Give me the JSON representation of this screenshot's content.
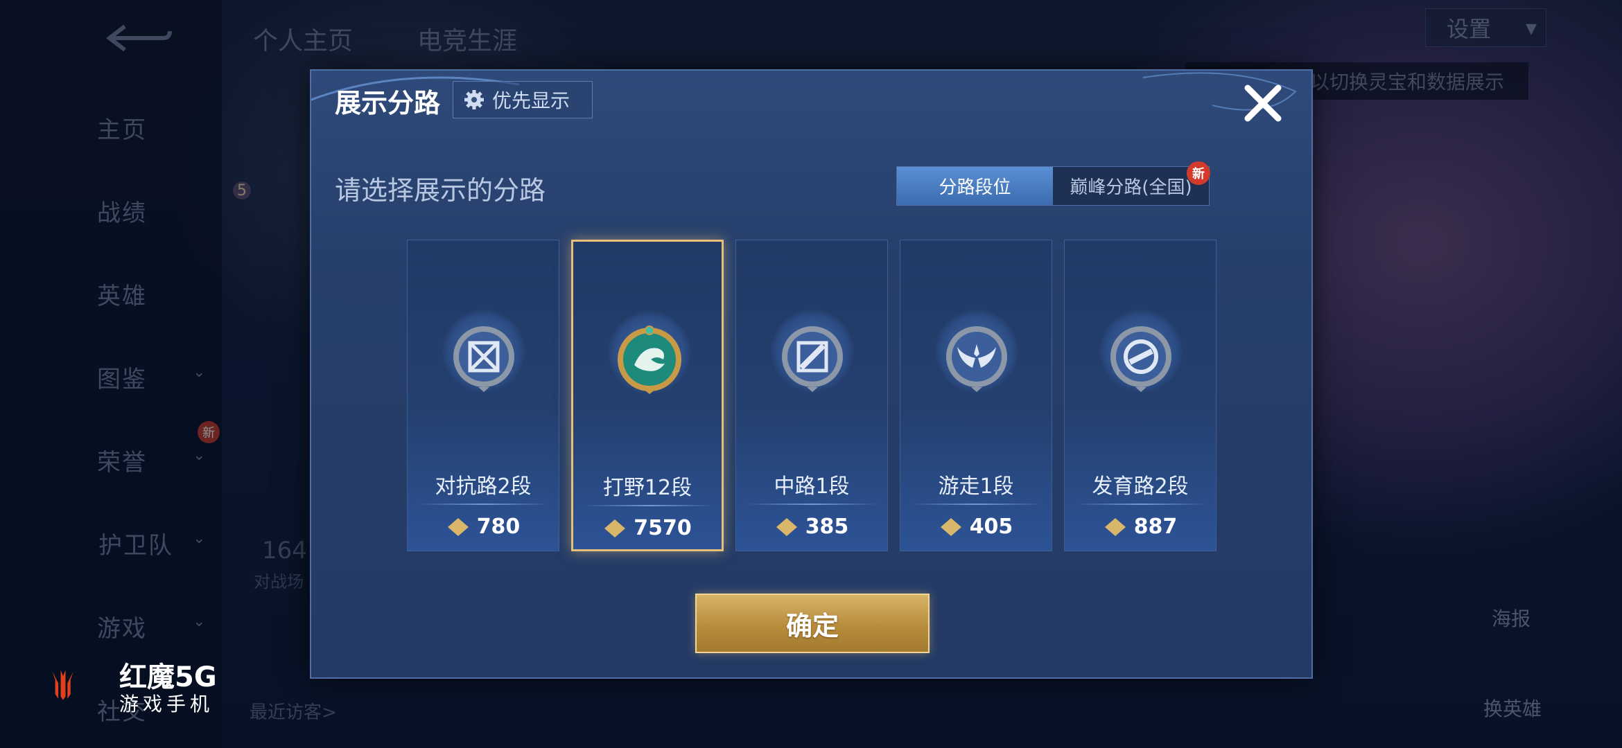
{
  "background": {
    "top_tabs": [
      "个人主页",
      "电竞生涯"
    ],
    "sidebar": {
      "items": [
        {
          "label": "主页"
        },
        {
          "label": "战绩"
        },
        {
          "label": "英雄"
        },
        {
          "label": "图鉴"
        },
        {
          "label": "荣誉"
        },
        {
          "label": "护卫队"
        },
        {
          "label": "游戏"
        },
        {
          "label": "社交"
        }
      ],
      "new_badge": "新"
    },
    "settings_label": "设置",
    "hint_text": "以切换灵宝和数据展示",
    "poster_label": "海报",
    "switch_hero_label": "换英雄",
    "recent_visitors": "最近访客>",
    "level": "5",
    "partial_stat_value": "164",
    "partial_stat_label": "对战场",
    "brand": {
      "name": "红魔5G",
      "sub": "游戏手机"
    }
  },
  "modal": {
    "title": "展示分路",
    "priority_label": "优先显示",
    "subtitle": "请选择展示的分路",
    "segment": {
      "active_label": "分路段位",
      "inactive_label": "巅峰分路(全国)",
      "new_badge": "新"
    },
    "cards": [
      {
        "label": "对抗路2段",
        "score": "780",
        "icon": "clash-lane-badge",
        "selected": false
      },
      {
        "label": "打野12段",
        "score": "7570",
        "icon": "jungle-dragon-badge",
        "selected": true
      },
      {
        "label": "中路1段",
        "score": "385",
        "icon": "mid-lane-badge",
        "selected": false
      },
      {
        "label": "游走1段",
        "score": "405",
        "icon": "roam-wing-badge",
        "selected": false
      },
      {
        "label": "发育路2段",
        "score": "887",
        "icon": "farm-lane-badge",
        "selected": false
      }
    ],
    "confirm_label": "确定"
  }
}
